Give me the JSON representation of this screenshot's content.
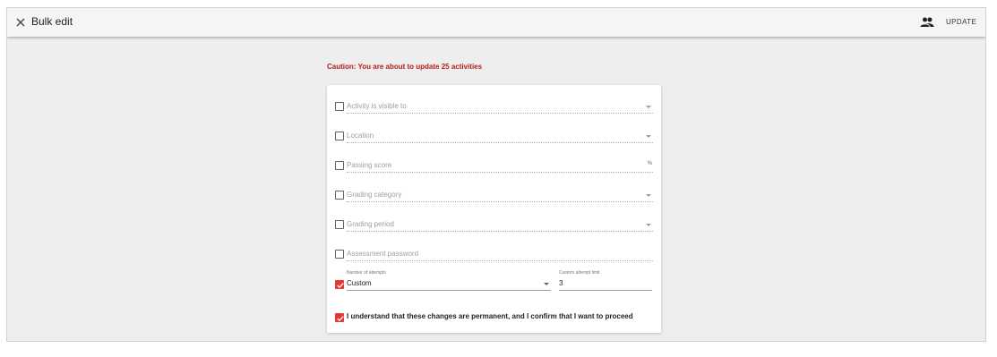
{
  "toolbar": {
    "title": "Bulk edit",
    "close_icon": "close-icon",
    "people_icon": "people-icon",
    "update_label": "UPDATE"
  },
  "caution": "Caution: You are about to update 25 activities",
  "fields": [
    {
      "label": "Activity is visible to",
      "type": "select",
      "checked": false
    },
    {
      "label": "Location",
      "type": "select",
      "checked": false
    },
    {
      "label": "Passing score",
      "type": "input",
      "suffix": "%",
      "checked": false
    },
    {
      "label": "Grading category",
      "type": "select",
      "checked": false
    },
    {
      "label": "Grading period",
      "type": "select",
      "checked": false
    },
    {
      "label": "Assessment password",
      "type": "input",
      "checked": false
    }
  ],
  "attempts": {
    "checked": true,
    "label": "Number of attempts",
    "value": "Custom",
    "limit_label": "Custom attempt limit",
    "limit_value": "3"
  },
  "confirm": {
    "checked": true,
    "text": "I understand that these changes are permanent, and I confirm that I want to proceed"
  },
  "colors": {
    "accent": "#e53935",
    "caution": "#b71c1c",
    "background": "#eeeeee"
  }
}
